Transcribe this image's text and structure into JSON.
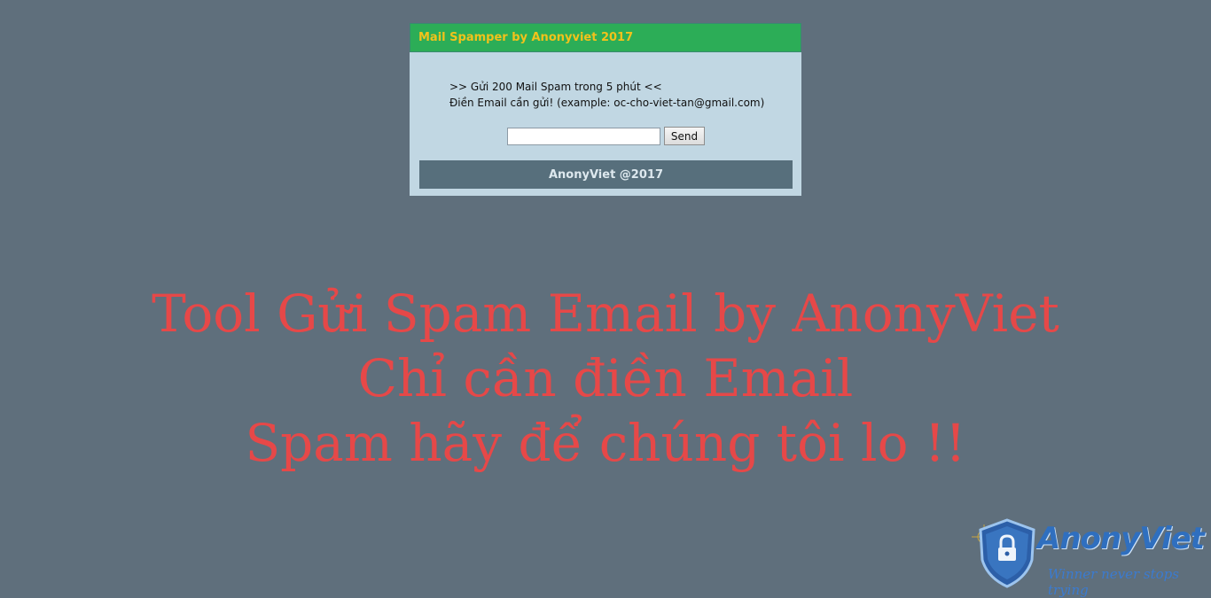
{
  "panel": {
    "title": "Mail Spamper by Anonyviet 2017",
    "line1": ">> Gửi 200 Mail Spam trong 5 phút <<",
    "line2": "Điền Email cần gửi! (example: oc-cho-viet-tan@gmail.com)",
    "email_value": "",
    "send_label": "Send",
    "footer": "AnonyViet @2017"
  },
  "headline": {
    "line1": "Tool Gửi Spam Email by AnonyViet",
    "line2": "Chỉ cần điền Email",
    "line3": "Spam hãy để chúng tôi lo !!"
  },
  "logo": {
    "name": "AnonyViet",
    "tagline": "Winner never stops trying",
    "icon": "shield-lock-icon"
  },
  "colors": {
    "background": "#5f6f7c",
    "header_bg": "#2cad57",
    "title_color": "#f2c21b",
    "headline_color": "#e64848"
  }
}
